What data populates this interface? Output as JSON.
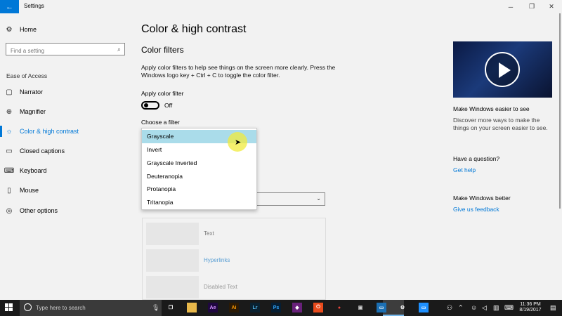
{
  "window": {
    "title": "Settings",
    "controls": [
      "─",
      "❐",
      "✕"
    ]
  },
  "sidebar": {
    "home": "Home",
    "search_placeholder": "Find a setting",
    "section": "Ease of Access",
    "items": [
      {
        "label": "Narrator",
        "icon": "narrator-icon"
      },
      {
        "label": "Magnifier",
        "icon": "magnifier-icon"
      },
      {
        "label": "Color & high contrast",
        "icon": "brightness-icon",
        "selected": true
      },
      {
        "label": "Closed captions",
        "icon": "captions-icon"
      },
      {
        "label": "Keyboard",
        "icon": "keyboard-icon"
      },
      {
        "label": "Mouse",
        "icon": "mouse-icon"
      },
      {
        "label": "Other options",
        "icon": "other-options-icon"
      }
    ]
  },
  "main": {
    "title": "Color & high contrast",
    "section_title": "Color filters",
    "description": "Apply color filters to help see things on the screen more clearly. Press the Windows logo key + Ctrl + C to toggle the color filter.",
    "apply_label": "Apply color filter",
    "toggle_state": "Off",
    "toggle_on": false,
    "choose_label": "Choose a filter",
    "filter_options": [
      "Grayscale",
      "Invert",
      "Grayscale Inverted",
      "Deuteranopia",
      "Protanopia",
      "Tritanopia"
    ],
    "highlighted_option": "Grayscale",
    "preview": {
      "text": "Text",
      "hyperlinks": "Hyperlinks",
      "disabled_text": "Disabled Text"
    }
  },
  "right_panel": {
    "video_title": "Make Windows easier to see",
    "video_text": "Discover more ways to make the things on your screen easier to see.",
    "question_head": "Have a question?",
    "help_link": "Get help",
    "better_head": "Make Windows better",
    "feedback_link": "Give us feedback"
  },
  "taskbar": {
    "search_placeholder": "Type here to search",
    "apps": [
      {
        "name": "task-view-icon",
        "glyph": "❐",
        "bg": "transparent",
        "fg": "#ffffff"
      },
      {
        "name": "file-explorer-icon",
        "glyph": "▬",
        "bg": "#e8b84a",
        "fg": "#e8b84a"
      },
      {
        "name": "after-effects-icon",
        "glyph": "Ae",
        "bg": "#1f0740",
        "fg": "#d291ff"
      },
      {
        "name": "illustrator-icon",
        "glyph": "Ai",
        "bg": "#2b1a05",
        "fg": "#ff9a00"
      },
      {
        "name": "lightroom-icon",
        "glyph": "Lr",
        "bg": "#0a2130",
        "fg": "#4fb3e8"
      },
      {
        "name": "photoshop-icon",
        "glyph": "Ps",
        "bg": "#061e33",
        "fg": "#31a8ff"
      },
      {
        "name": "visual-studio-icon",
        "glyph": "◆",
        "bg": "#68217a",
        "fg": "#ffffff"
      },
      {
        "name": "power-icon",
        "glyph": "⏻",
        "bg": "#e84b1c",
        "fg": "#ffffff"
      },
      {
        "name": "chrome-icon",
        "glyph": "●",
        "bg": "transparent",
        "fg": "#e8453c"
      },
      {
        "name": "app-icon",
        "glyph": "▣",
        "bg": "transparent",
        "fg": "#cfcfcf"
      },
      {
        "name": "photos-icon",
        "glyph": "▭",
        "bg": "#1b6fb3",
        "fg": "#ffffff"
      },
      {
        "name": "settings-gear-icon",
        "glyph": "⚙",
        "bg": "transparent",
        "fg": "#ffffff"
      },
      {
        "name": "remote-icon",
        "glyph": "▭",
        "bg": "#1e90ff",
        "fg": "#ffffff"
      }
    ],
    "time": "11:36 PM",
    "date": "8/19/2017"
  },
  "colors": {
    "accent": "#0078d7",
    "highlight": "#aadcea",
    "taskbar": "#1a1a1a"
  }
}
